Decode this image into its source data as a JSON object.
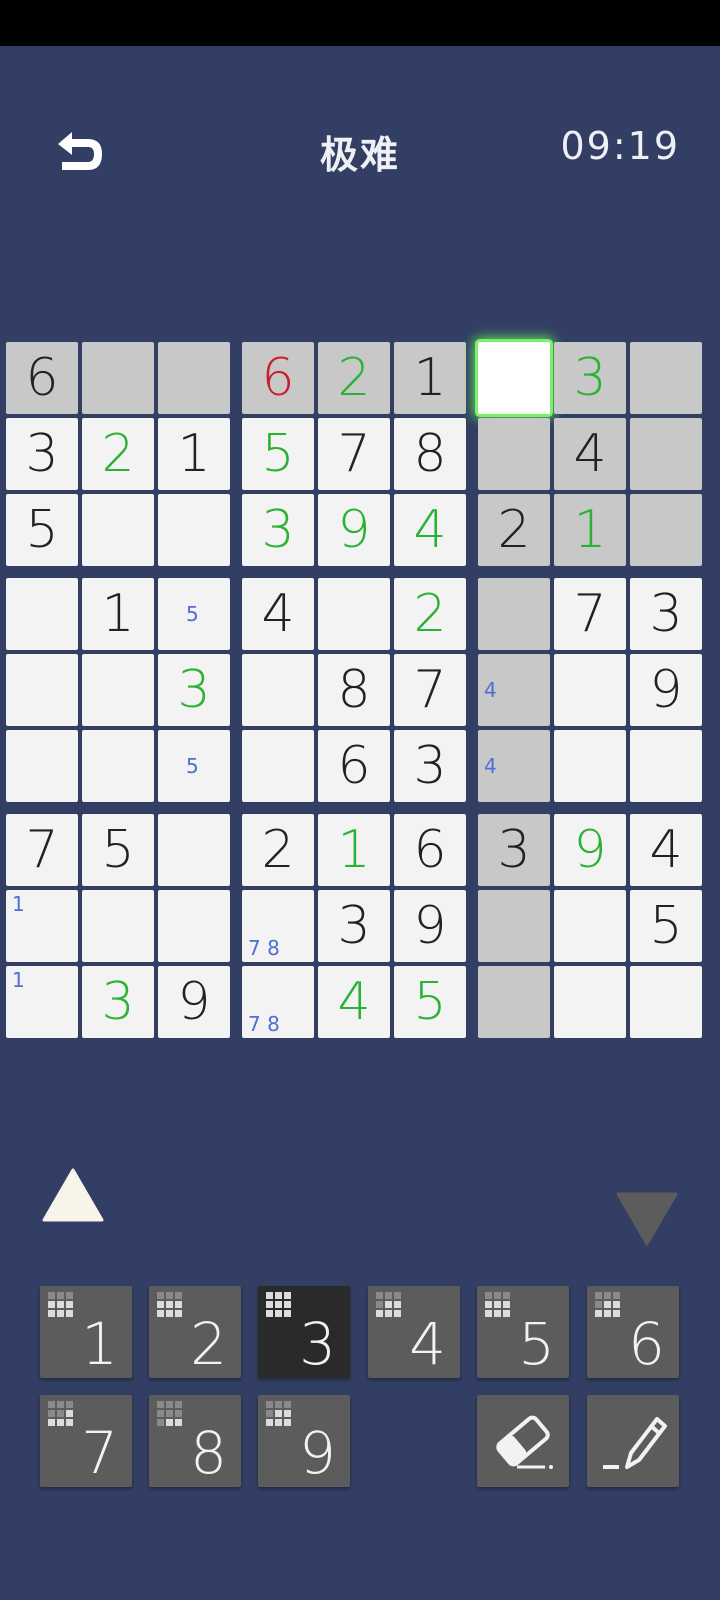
{
  "header": {
    "title": "极难",
    "timer": "09:19",
    "back_icon": "back-arrow-icon"
  },
  "colors": {
    "background": "#323e63",
    "given": "#222222",
    "user_correct": "#2bb234",
    "user_error": "#c8202b",
    "note": "#4e6fd3",
    "selected_glow": "#5fe85a",
    "highlight": "#c8c8c8"
  },
  "board": {
    "values": [
      [
        "6",
        "",
        "",
        "6",
        "2",
        "1",
        "",
        "3",
        ""
      ],
      [
        "3",
        "2",
        "1",
        "5",
        "7",
        "8",
        "",
        "4",
        ""
      ],
      [
        "5",
        "",
        "",
        "3",
        "9",
        "4",
        "2",
        "1",
        ""
      ],
      [
        "",
        "1",
        "",
        "4",
        "",
        "2",
        "",
        "7",
        "3"
      ],
      [
        "",
        "",
        "3",
        "",
        "8",
        "7",
        "",
        "",
        "9"
      ],
      [
        "",
        "",
        "",
        "",
        "6",
        "3",
        "",
        "",
        ""
      ],
      [
        "7",
        "5",
        "",
        "2",
        "1",
        "6",
        "3",
        "9",
        "4"
      ],
      [
        "",
        "",
        "",
        "",
        "3",
        "9",
        "",
        "",
        "5"
      ],
      [
        "",
        "3",
        "9",
        "",
        "4",
        "5",
        "",
        "",
        ""
      ]
    ],
    "kinds": [
      [
        "g",
        "",
        "",
        "e",
        "u",
        "g",
        "",
        "u",
        ""
      ],
      [
        "g",
        "u",
        "g",
        "u",
        "g",
        "g",
        "",
        "g",
        ""
      ],
      [
        "g",
        "",
        "",
        "u",
        "u",
        "u",
        "g",
        "u",
        ""
      ],
      [
        "",
        "g",
        "",
        "g",
        "",
        "u",
        "",
        "g",
        "g"
      ],
      [
        "",
        "",
        "u",
        "",
        "g",
        "g",
        "",
        "",
        "g"
      ],
      [
        "",
        "",
        "",
        "",
        "g",
        "g",
        "",
        "",
        ""
      ],
      [
        "g",
        "g",
        "",
        "g",
        "u",
        "g",
        "g",
        "u",
        "g"
      ],
      [
        "",
        "",
        "",
        "",
        "g",
        "g",
        "",
        "",
        "g"
      ],
      [
        "",
        "u",
        "g",
        "",
        "u",
        "u",
        "",
        "",
        ""
      ]
    ],
    "selected": {
      "row": 0,
      "col": 6
    },
    "highlighted_cells": [
      [
        0,
        0
      ],
      [
        0,
        1
      ],
      [
        0,
        2
      ],
      [
        0,
        3
      ],
      [
        0,
        4
      ],
      [
        0,
        5
      ],
      [
        0,
        7
      ],
      [
        0,
        8
      ],
      [
        1,
        6
      ],
      [
        1,
        7
      ],
      [
        1,
        8
      ],
      [
        2,
        6
      ],
      [
        2,
        7
      ],
      [
        2,
        8
      ],
      [
        3,
        6
      ],
      [
        4,
        6
      ],
      [
        5,
        6
      ],
      [
        6,
        6
      ],
      [
        7,
        6
      ],
      [
        8,
        6
      ]
    ],
    "notes": [
      {
        "row": 3,
        "col": 2,
        "text": "5",
        "pos": "center"
      },
      {
        "row": 5,
        "col": 2,
        "text": "5",
        "pos": "center"
      },
      {
        "row": 4,
        "col": 6,
        "text": "4",
        "pos": "left"
      },
      {
        "row": 5,
        "col": 6,
        "text": "4",
        "pos": "left"
      },
      {
        "row": 7,
        "col": 0,
        "text": "1",
        "pos": "topleft"
      },
      {
        "row": 8,
        "col": 0,
        "text": "1",
        "pos": "topleft"
      },
      {
        "row": 7,
        "col": 3,
        "text": "7 8",
        "pos": "bottom"
      },
      {
        "row": 8,
        "col": 3,
        "text": "7 8",
        "pos": "bottom"
      }
    ]
  },
  "controls": {
    "up_icon": "triangle-up-icon",
    "down_icon": "triangle-down-icon",
    "keys": [
      {
        "label": "1",
        "active": false,
        "remaining": 3
      },
      {
        "label": "2",
        "active": false,
        "remaining": 3
      },
      {
        "label": "3",
        "active": true,
        "remaining": 0
      },
      {
        "label": "4",
        "active": false,
        "remaining": 4
      },
      {
        "label": "5",
        "active": false,
        "remaining": 3
      },
      {
        "label": "6",
        "active": false,
        "remaining": 4
      },
      {
        "label": "7",
        "active": false,
        "remaining": 5
      },
      {
        "label": "8",
        "active": false,
        "remaining": 7
      },
      {
        "label": "9",
        "active": false,
        "remaining": 4
      }
    ],
    "eraser_icon": "eraser-icon",
    "pencil_icon": "pencil-icon"
  }
}
